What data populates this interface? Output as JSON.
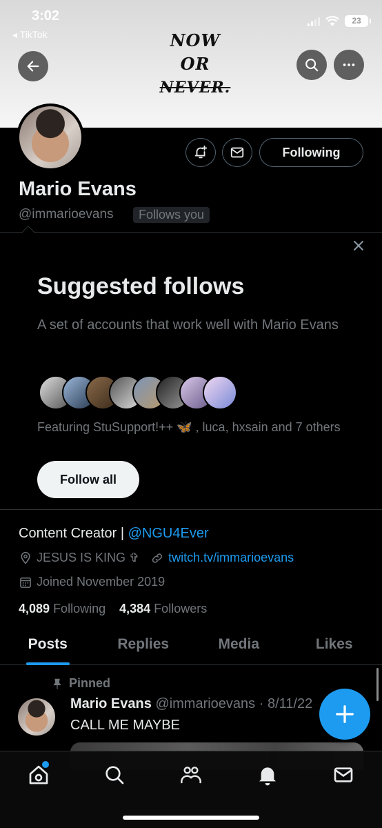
{
  "status_bar": {
    "time": "3:02",
    "back_app": "◂ TikTok",
    "battery": "23"
  },
  "banner": {
    "lines": [
      "NOW",
      "OR",
      "NEVER."
    ]
  },
  "header": {
    "back_icon": "arrow-left-icon",
    "search_icon": "search-icon",
    "more_icon": "more-icon"
  },
  "profile": {
    "display_name": "Mario Evans",
    "handle": "@immarioevans",
    "follows_you": "Follows you",
    "following_button": "Following",
    "bio_text": "Content Creator | ",
    "bio_mention": "@NGU4Ever",
    "location": "JESUS IS KING ✞",
    "website": "twitch.tv/immarioevans",
    "joined": "Joined November 2019",
    "following_count": "4,089",
    "following_label": "Following",
    "followers_count": "4,384",
    "followers_label": "Followers"
  },
  "suggested": {
    "title": "Suggested follows",
    "description": "A set of accounts that work well with Mario Evans",
    "featuring": "Featuring StuSupport!++ 🦋 , luca, hxsain and 7 others",
    "follow_all": "Follow all"
  },
  "tabs": [
    "Posts",
    "Replies",
    "Media",
    "Likes"
  ],
  "post": {
    "pinned_label": "Pinned",
    "author": "Mario Evans",
    "meta": "@immarioevans · 8/11/22",
    "text": "CALL ME MAYBE"
  },
  "colors": {
    "accent": "#1d9bf0",
    "background": "#000000",
    "muted_text": "#71767b"
  }
}
